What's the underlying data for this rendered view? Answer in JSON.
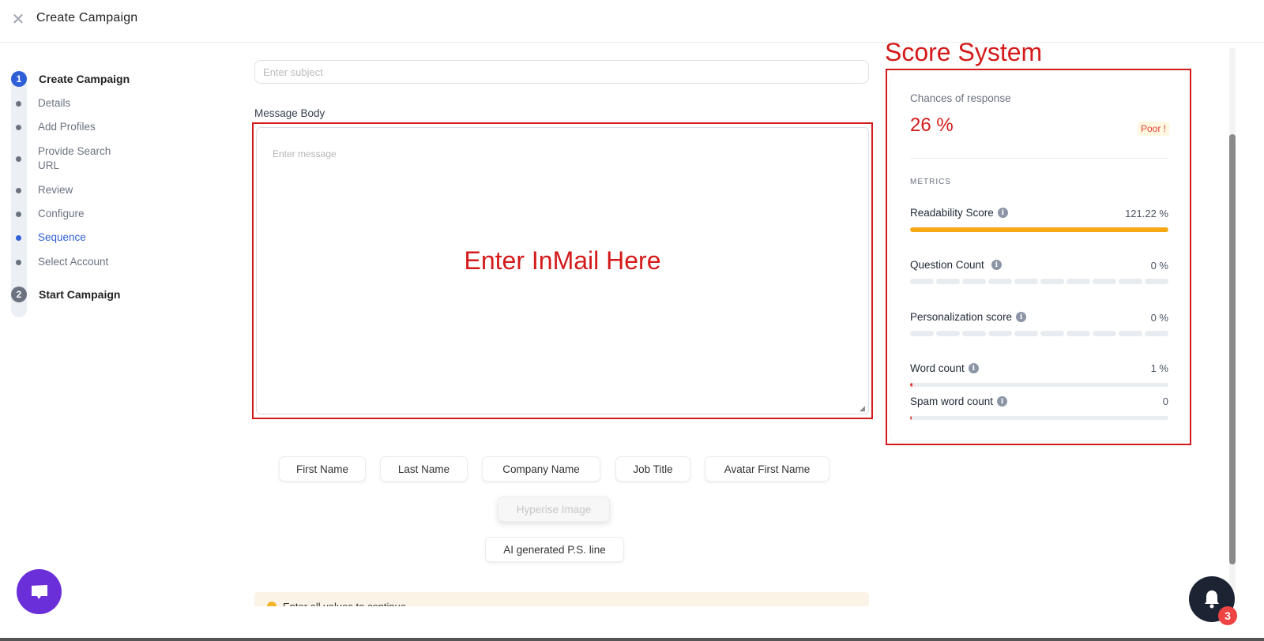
{
  "header": {
    "title": "Create Campaign",
    "close_icon": "close-icon"
  },
  "stepper": {
    "steps": [
      {
        "number": "1",
        "label": "Create Campaign",
        "active": true
      },
      {
        "number": "2",
        "label": "Start Campaign",
        "active": false
      }
    ],
    "substeps": [
      {
        "label": "Details",
        "active": false
      },
      {
        "label": "Add Profiles",
        "active": false
      },
      {
        "label": "Provide Search URL",
        "active": false
      },
      {
        "label": "Review",
        "active": false
      },
      {
        "label": "Configure",
        "active": false
      },
      {
        "label": "Sequence",
        "active": true
      },
      {
        "label": "Select Account",
        "active": false
      }
    ]
  },
  "form": {
    "subject_placeholder": "Enter subject",
    "subject_value": "",
    "message_label": "Message Body",
    "message_placeholder": "Enter message",
    "message_value": "",
    "annotation": "Enter InMail Here"
  },
  "variables": [
    "First Name",
    "Last Name",
    "Company Name",
    "Job Title",
    "Avatar First Name",
    "Hyperise Image",
    "AI generated P.S. line"
  ],
  "warning": {
    "text": "Enter all values to continue"
  },
  "score": {
    "annotation": "Score System",
    "chances_label": "Chances of response",
    "chances_value": "26 %",
    "rating": "Poor !",
    "metrics_label": "METRICS",
    "metrics": [
      {
        "name": "Readability Score",
        "value": "121.22 %",
        "progress": 100,
        "color": "#f5a716",
        "style": "bar"
      },
      {
        "name": "Question Count",
        "value": "0 %",
        "progress": 0,
        "style": "segmented"
      },
      {
        "name": "Personalization score",
        "value": "0 %",
        "progress": 0,
        "style": "segmented"
      },
      {
        "name": "Word count",
        "value": "1 %",
        "progress": 1,
        "color": "#e2433b",
        "style": "bar"
      },
      {
        "name": "Spam word count",
        "value": "0",
        "progress": 0,
        "color": "#e2433b",
        "style": "bar"
      }
    ]
  },
  "notifications": {
    "count": "3"
  },
  "colors": {
    "accent": "#2f5fd6",
    "annotation": "#d41a1a",
    "chat": "#6b2fd9",
    "bell": "#1c2333"
  }
}
